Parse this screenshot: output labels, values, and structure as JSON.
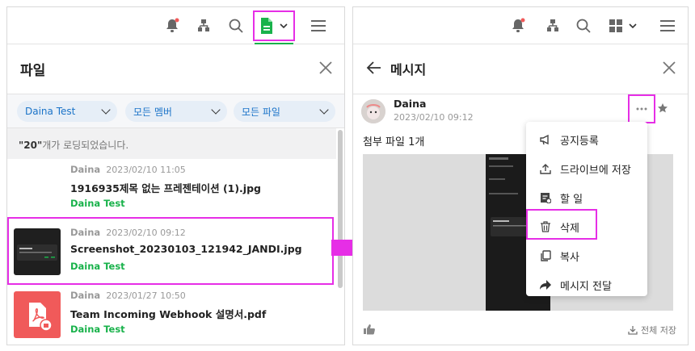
{
  "left": {
    "title": "파일",
    "filters": [
      "Daina Test",
      "모든 멤버",
      "모든 파일"
    ],
    "loaded_count": "\"20\"",
    "loaded_suffix": "개가 로딩되었습니다.",
    "files": [
      {
        "author": "Daina",
        "date": "2023/02/10 11:05",
        "name": "1916935제목 없는 프레젠테이션 (1).jpg",
        "team": "Daina Test",
        "thumb": "none"
      },
      {
        "author": "Daina",
        "date": "2023/02/10 09:12",
        "name": "Screenshot_20230103_121942_JANDI.jpg",
        "team": "Daina Test",
        "thumb": "image"
      },
      {
        "author": "Daina",
        "date": "2023/01/27 10:50",
        "name": "Team Incoming Webhook 설명서.pdf",
        "team": "Daina Test",
        "thumb": "pdf"
      }
    ]
  },
  "right": {
    "title": "메시지",
    "sender": "Daina",
    "date": "2023/02/10 09:12",
    "attachment_text": "첨부 파일 1개",
    "menu": [
      "공지등록",
      "드라이브에 저장",
      "할 일",
      "삭제",
      "복사",
      "메시지 전달"
    ],
    "save_all": "전체 저장"
  },
  "colors": {
    "accent_green": "#19b24b",
    "highlight": "#e62ee6",
    "filter_text": "#1a73c8",
    "notif_dot": "#f05a5a"
  }
}
